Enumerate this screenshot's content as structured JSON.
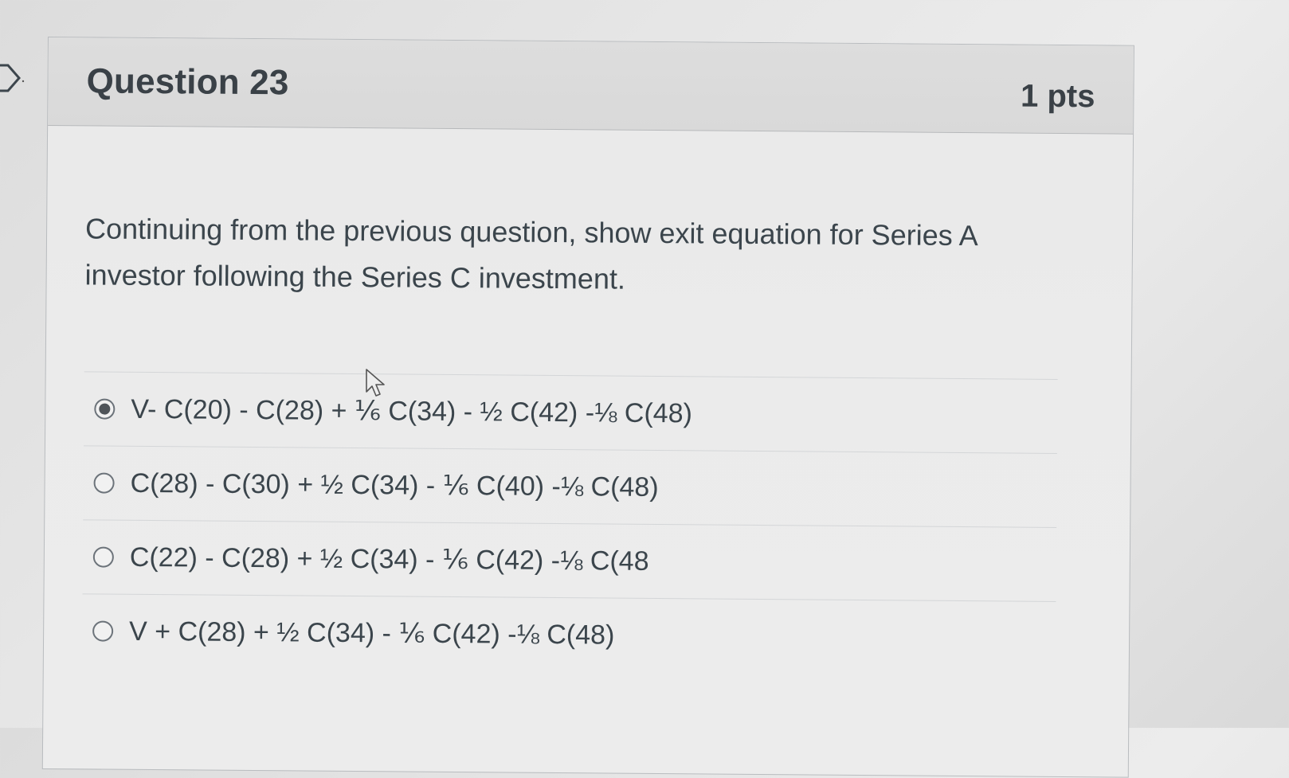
{
  "question": {
    "title": "Question 23",
    "points": "1 pts",
    "text": "Continuing from the previous question, show exit equation for Series A investor following the Series C investment."
  },
  "answers": [
    {
      "label": "V- C(20) - C(28) + ⅙ C(34) - ½ C(42) -⅛ C(48)",
      "selected": true
    },
    {
      "label": "C(28) - C(30) + ½ C(34) - ⅙ C(40) -⅛ C(48)",
      "selected": false
    },
    {
      "label": "C(22) - C(28) + ½ C(34) - ⅙ C(42) -⅛ C(48",
      "selected": false
    },
    {
      "label": "V +  C(28) + ½ C(34) - ⅙ C(42) -⅛ C(48)",
      "selected": false
    }
  ],
  "icons": {
    "flag": "flag-outline-icon",
    "cursor": "mouse-pointer-icon",
    "radio_selected": "radio-selected-icon",
    "radio_unselected": "radio-unselected-icon"
  },
  "colors": {
    "text": "#3b454c",
    "header_bg": "#dadada",
    "border": "#b9bcbf"
  }
}
